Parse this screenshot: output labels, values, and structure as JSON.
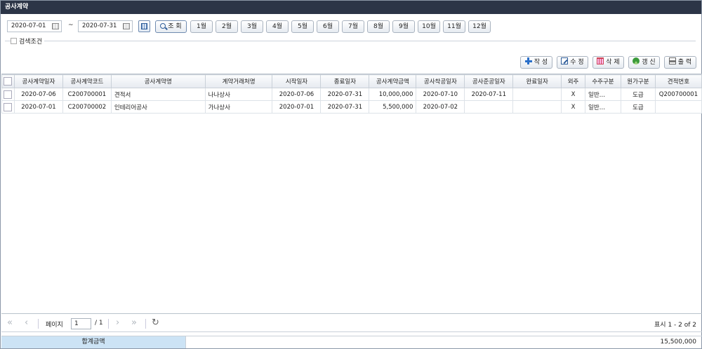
{
  "title": "공사계약",
  "filter": {
    "date_from": "2020-07-01",
    "tilde": "~",
    "date_to": "2020-07-31",
    "search_label": "조 회",
    "months": [
      "1월",
      "2월",
      "3월",
      "4월",
      "5월",
      "6월",
      "7월",
      "8월",
      "9월",
      "10월",
      "11월",
      "12월"
    ],
    "condition_label": "검색조건"
  },
  "actions": {
    "create": "작 성",
    "edit": "수 정",
    "delete": "삭 제",
    "refresh": "갱 신",
    "print": "출 력"
  },
  "table": {
    "columns": [
      "공사계약일자",
      "공사계약코드",
      "공사계약명",
      "계약거래처명",
      "시작일자",
      "종료일자",
      "공사계약금액",
      "공사착공일자",
      "공사준공일자",
      "완료일자",
      "외주",
      "수주구분",
      "원가구분",
      "견적번호"
    ],
    "rows": [
      [
        "2020-07-06",
        "C200700001",
        "견적서",
        "나나상사",
        "2020-07-06",
        "2020-07-31",
        "10,000,000",
        "2020-07-10",
        "2020-07-11",
        "",
        "X",
        "일반…",
        "도급",
        "Q200700001"
      ],
      [
        "2020-07-01",
        "C200700002",
        "인테리어공사",
        "가나상사",
        "2020-07-01",
        "2020-07-31",
        "5,500,000",
        "2020-07-02",
        "",
        "",
        "X",
        "일반…",
        "도급",
        ""
      ]
    ]
  },
  "pager": {
    "page_label": "페이지",
    "page": "1",
    "total": "/ 1",
    "info": "표시 1 - 2 of 2"
  },
  "footer": {
    "total_label": "합계금액",
    "total_value": "15,500,000"
  }
}
